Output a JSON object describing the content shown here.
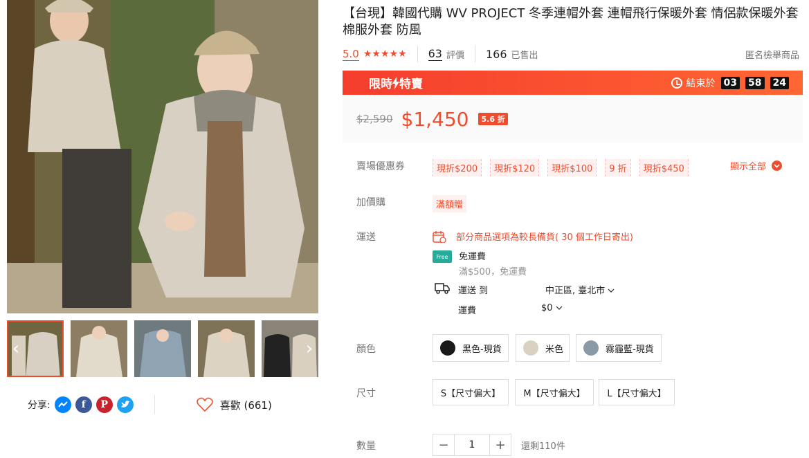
{
  "product": {
    "title": "【台現】韓國代購 WV PROJECT 冬季連帽外套 連帽飛行保暖外套 情侶款保暖外套 棉服外套 防風",
    "rating": "5.0",
    "stars": "★★★★★",
    "reviews_count": "63",
    "reviews_label": "評價",
    "sold_count": "166",
    "sold_label": "已售出",
    "report_label": "匿名檢舉商品"
  },
  "flash_sale": {
    "title_a": "限時",
    "title_b": "特賣",
    "ends_label": "結束於",
    "hours": "03",
    "minutes": "58",
    "seconds": "24"
  },
  "price": {
    "original": "$2,590",
    "sale": "$1,450",
    "discount": "5.6 折"
  },
  "vouchers": {
    "label": "賣場優惠券",
    "items": [
      "現折$200",
      "現折$120",
      "現折$100",
      "9 折",
      "現折$450"
    ],
    "show_all": "顯示全部"
  },
  "addon": {
    "label": "加價購",
    "tag": "滿額贈"
  },
  "shipping": {
    "label": "運送",
    "note": "部分商品選項為較長備貨( 30 個工作日寄出)",
    "free_badge": "Free",
    "free_title": "免運費",
    "free_condition": "滿$500，免運費",
    "to_label": "運送 到",
    "to_value": "中正區, 臺北市",
    "fee_label": "運費",
    "fee_value": "$0"
  },
  "color": {
    "label": "顏色",
    "options": [
      "黑色-現貨",
      "米色",
      "霧霾藍-現貨"
    ],
    "swatch_colors": [
      "#1a1a1a",
      "#d9d2c2",
      "#8a9aa6"
    ]
  },
  "size": {
    "label": "尺寸",
    "options": [
      "S【尺寸偏大】",
      "M【尺寸偏大】",
      "L【尺寸偏大】"
    ]
  },
  "quantity": {
    "label": "數量",
    "value": "1",
    "minus": "−",
    "plus": "+",
    "stock": "還剩110件"
  },
  "share": {
    "label": "分享:",
    "like_label": "喜歡 (661)"
  },
  "colors": {
    "accent": "#ee4d2d",
    "free_green": "#26aa99"
  }
}
